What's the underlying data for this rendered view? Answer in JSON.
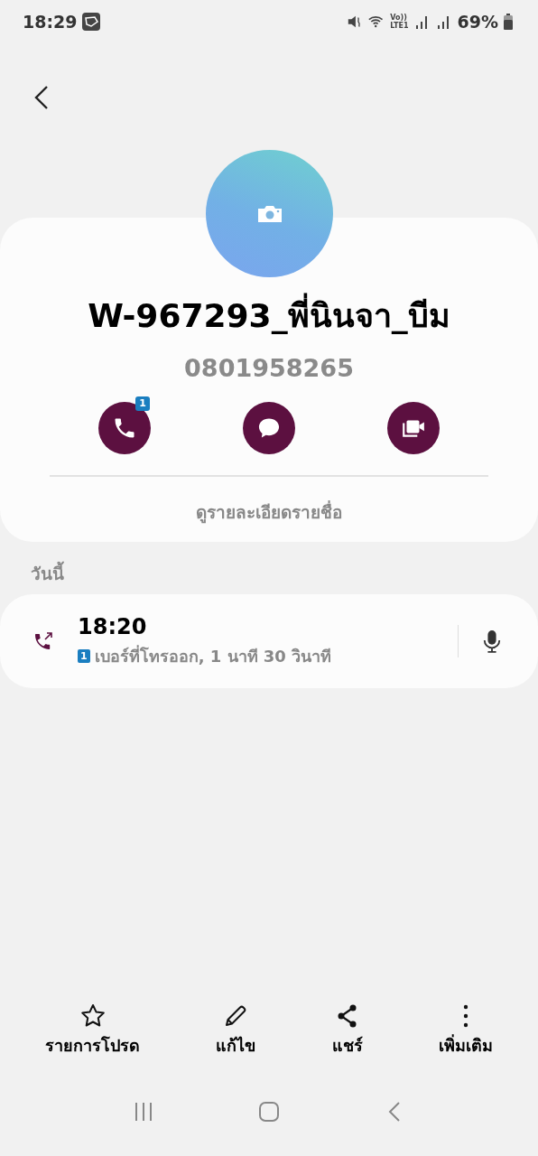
{
  "status_bar": {
    "time": "18:29",
    "volte": "Vo))",
    "lte": "LTE1",
    "battery": "69%"
  },
  "contact": {
    "name": "W-967293_พี่นินจา_บีม",
    "phone": "0801958265",
    "details_link": "ดูรายละเอียดรายชื่อ",
    "actions": [
      {
        "kind": "call",
        "badge": "1"
      },
      {
        "kind": "message"
      },
      {
        "kind": "video"
      }
    ]
  },
  "history": {
    "heading": "วันนี้",
    "entries": [
      {
        "time": "18:20",
        "sim": "1",
        "description": "เบอร์ที่โทรออก, 1 นาที 30 วินาที"
      }
    ]
  },
  "bottom_bar": [
    {
      "kind": "star",
      "label": "รายการโปรด"
    },
    {
      "kind": "edit",
      "label": "แก้ไข"
    },
    {
      "kind": "share",
      "label": "แชร์"
    },
    {
      "kind": "more",
      "label": "เพิ่มเติม"
    }
  ]
}
